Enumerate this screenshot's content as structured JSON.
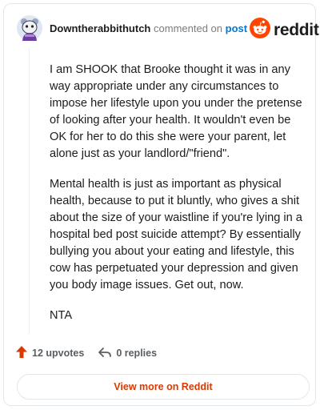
{
  "comment": {
    "username": "Downtherabbithutch",
    "action_text": "commented on",
    "post_link": "post",
    "paragraphs": [
      "I am SHOOK that Brooke thought it was in any way appropriate under any circumstances to impose her lifestyle upon you under the pretense of looking after your health. It wouldn't even be OK for her to do this she were your parent, let alone just as your landlord/\"friend\".",
      "Mental health is just as important as physical health, because to put it bluntly, who gives a shit about the size of your waistline if you're lying in a hospital bed post suicide attempt? By essentially bullying you about your eating and lifestyle, this cow has perpetuated your depression and given you body image issues. Get out, now.",
      "NTA"
    ]
  },
  "brand": {
    "wordmark": "reddit",
    "icon": "reddit-snoo-icon",
    "color": "#ff4500"
  },
  "footer": {
    "upvotes": "12 upvotes",
    "upvote_icon": "upvote-arrow-icon",
    "upvote_color": "#d93a00",
    "replies": "0 replies",
    "reply_icon": "reply-arrow-icon"
  },
  "view_button": {
    "label": "View more on Reddit",
    "color": "#d93a00"
  }
}
